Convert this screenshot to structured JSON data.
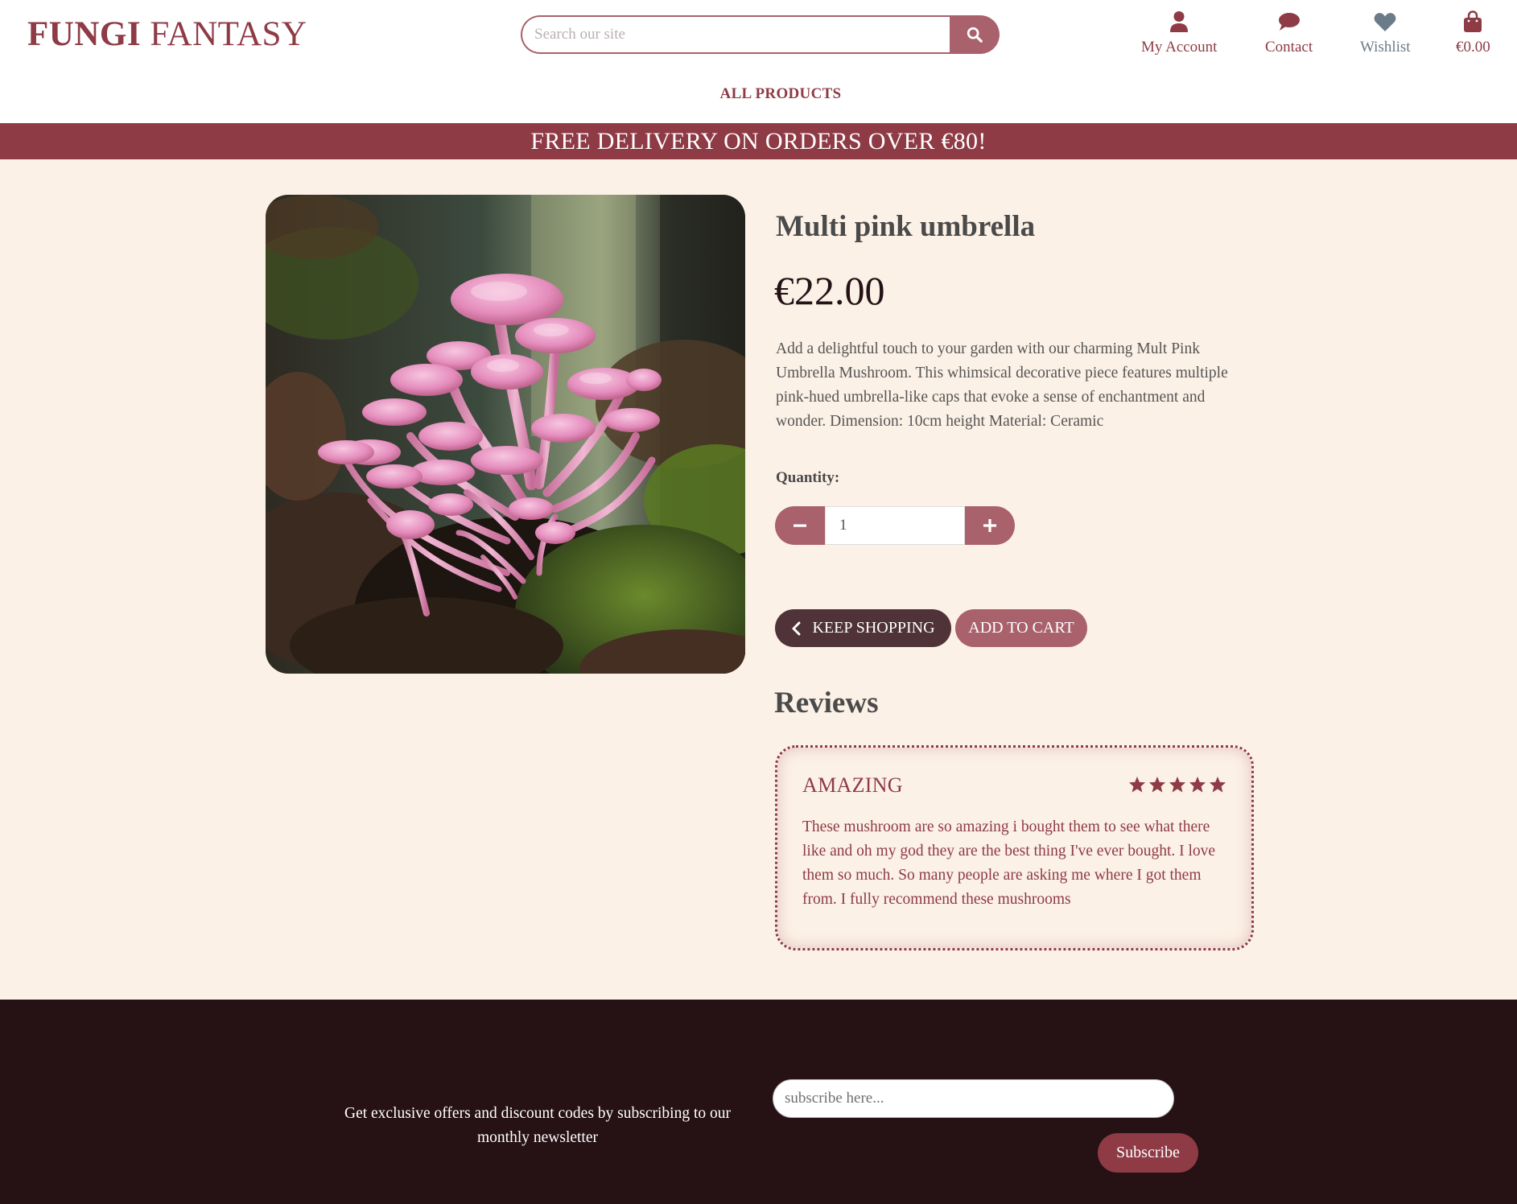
{
  "header": {
    "logo_bold": "FUNGI",
    "logo_rest": "FANTASY",
    "search_placeholder": "Search our site",
    "nav": {
      "account": "My Account",
      "contact": "Contact",
      "wishlist": "Wishlist",
      "cart": "€0.00"
    },
    "all_products": "ALL PRODUCTS"
  },
  "banner": "FREE DELIVERY ON ORDERS OVER €80!",
  "product": {
    "title": "Multi pink umbrella",
    "price": "€22.00",
    "description": "Add a delightful touch to your garden with our charming Mult Pink Umbrella Mushroom. This whimsical decorative piece features multiple pink-hued umbrella-like caps that evoke a sense of enchantment and wonder. Dimension: 10cm height Material: Ceramic",
    "quantity_label": "Quantity:",
    "quantity_value": "1",
    "keep_shopping": "KEEP SHOPPING",
    "add_to_cart": "ADD TO CART"
  },
  "reviews": {
    "title": "Reviews",
    "items": [
      {
        "title": "AMAZING",
        "rating": 5,
        "body": "These mushroom are so amazing i bought them to see what there like and oh my god they are the best thing I've ever bought. I love them so much. So many people are asking me where I got them from. I fully recommend these mushrooms"
      }
    ]
  },
  "footer": {
    "newsletter_text": "Get exclusive offers and discount codes by subscribing to our monthly newsletter",
    "subscribe_placeholder": "subscribe here...",
    "subscribe_button": "Subscribe"
  },
  "colors": {
    "brand": "#8e3b46",
    "accent": "#a9626c",
    "dark_button": "#4f3338",
    "background": "#fcf1e6",
    "footer": "#261115"
  },
  "icons": {
    "search": "search-icon",
    "account": "user-icon",
    "contact": "speech-bubble-icon",
    "wishlist": "heart-icon",
    "cart": "shopping-bag-icon",
    "minus": "minus-icon",
    "plus": "plus-icon",
    "back": "chevron-left-icon",
    "star": "star-icon"
  }
}
